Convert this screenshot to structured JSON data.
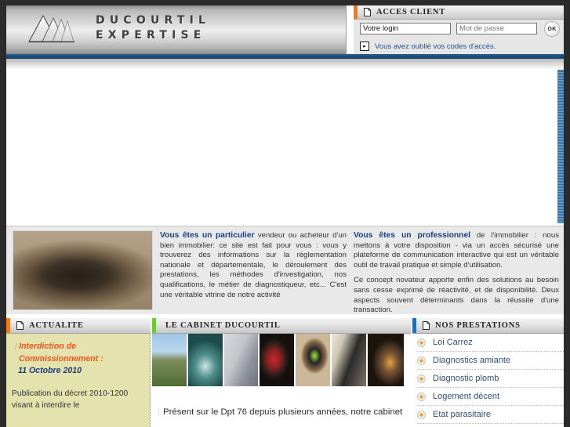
{
  "header": {
    "logo": {
      "icon": "mountain-peaks-logo",
      "line1": "DUCOURTIL",
      "line2": "EXPERTISE"
    }
  },
  "acces_client": {
    "title": "ACCES CLIENT",
    "accent_color": "#f07d18",
    "icon": "document-icon",
    "login_placeholder": "Votre login",
    "login_value": "Votre login",
    "password_placeholder": "Mot de passe",
    "password_value": "Mot de passe",
    "ok_label": "OK",
    "forgot_icon": "arrow-right-icon",
    "forgot_link": "Vous avez oublié vos codes d'accès."
  },
  "intro": {
    "particulier": {
      "lead": "Vous êtes un particulier",
      "body": " vendeur ou acheteur d'un bien immobilier: ce site est fait pour vous : vous y trouverez des informations sur la réglementation nationale et départementale, le déroulement des prestations, les méthodes d'investigation, nos qualifications, le métier de diagnostiqueur, etc... C'est une véritable vitrine de notre activité"
    },
    "professionnel": {
      "lead": "Vous êtes un professionnel",
      "body1": " de l'immobilier : nous mettons à votre disposition - via un accès sécurisé une plateforme de communication interactive qui est un véritable outil de travail pratique et simple d'utilisation.",
      "body2": "Ce concept novateur apporte enfin des solutions au besoin sans cesse exprimé de réactivité, et de disponibilité. Deux aspects souvent déterminants dans la réussite d'une transaction."
    },
    "photo_alt": "hand-on-mouse-photo"
  },
  "columns": {
    "actualite": {
      "title": "ACTUALITE",
      "accent_color": "#f07d18",
      "icon": "document-icon",
      "news_title_line1": "Interdiction de",
      "news_title_line2": "Commissionnement :",
      "news_date": "11 Octobre 2010",
      "news_body": "Publication du décret 2010-1200 visant à interdire le"
    },
    "cabinet": {
      "title": "LE CABINET DUCOURTIL",
      "accent_color": "#6ecb2b",
      "icon": "none",
      "photos": [
        "chateau-photo",
        "inspector-photo",
        "facade-photo",
        "technician-red-jacket-photo",
        "device-in-hand-photo",
        "timber-frame-house-photo",
        "attic-inspection-photo"
      ],
      "text": "Présent sur le Dpt 76 depuis plusieurs années, notre cabinet"
    },
    "prestations": {
      "title": "NOS PRESTATIONS",
      "accent_color": "#1f6fc0",
      "icon": "document-icon",
      "items": [
        {
          "label": "Loi Carrez"
        },
        {
          "label": "Diagnostics amiante"
        },
        {
          "label": "Diagnostic plomb"
        },
        {
          "label": "Logement décent"
        },
        {
          "label": "Etat parasitaire"
        }
      ]
    }
  }
}
